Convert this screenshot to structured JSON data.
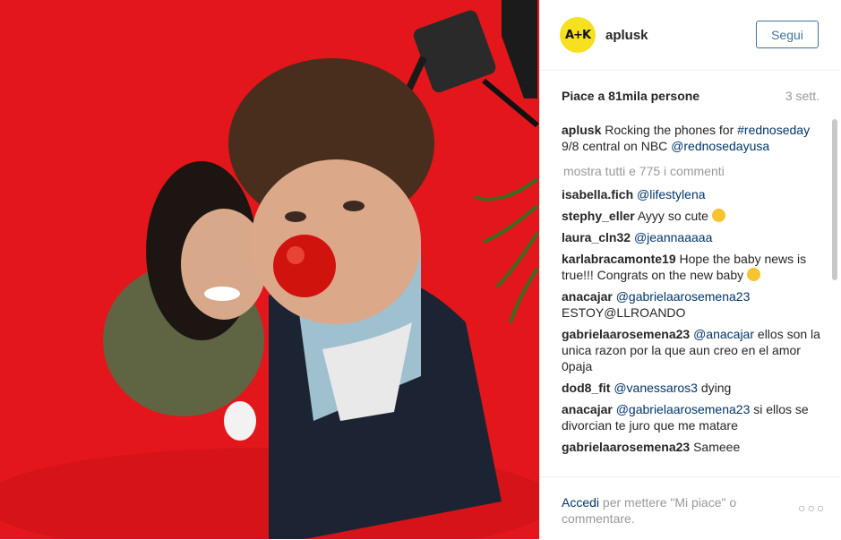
{
  "post": {
    "username": "aplusk",
    "avatar_text": "A+K",
    "follow_label": "Segui",
    "likes_text": "Piace a 81mila persone",
    "time_ago": "3 sett.",
    "caption": {
      "author": "aplusk",
      "text_before": "Rocking the phones for",
      "hashtag": "#rednoseday",
      "text_after": "9/8 central on NBC",
      "mention": "@rednosedayusa"
    },
    "show_all_comments": "mostra tutti e 775 i commenti"
  },
  "comments": [
    {
      "user": "isabella.fich",
      "mention": "@lifestylena",
      "text": ""
    },
    {
      "user": "stephy_eller",
      "mention": "",
      "text": "Ayyy so cute"
    },
    {
      "user": "laura_cln32",
      "mention": "@jeannaaaaa",
      "text": ""
    },
    {
      "user": "karlabracamonte19",
      "mention": "",
      "text": "Hope the baby news is true!!! Congrats on the new baby"
    },
    {
      "user": "anacajar",
      "mention": "@gabrielaarosemena23",
      "text": "ESTOY@LLROANDO"
    },
    {
      "user": "gabrielaarosemena23",
      "mention": "@anacajar",
      "text": "ellos son la unica razon por la que aun creo en el amor 0paja"
    },
    {
      "user": "dod8_fit",
      "mention": "@vanessaros3",
      "text": "dying"
    },
    {
      "user": "anacajar",
      "mention": "@gabrielaarosemena23",
      "text": "si ellos se divorcian te juro que me matare"
    },
    {
      "user": "gabrielaarosemena23",
      "mention": "",
      "text": "Sameee"
    }
  ],
  "footer": {
    "login_link": "Accedi",
    "login_text": "per mettere \"Mi piace\" o commentare.",
    "more_icon": "ellipsis-icon"
  },
  "colors": {
    "background_red": "#e5141a",
    "link_blue": "#003569",
    "follow_blue": "#3f729b",
    "avatar_yellow": "#f5e120"
  }
}
